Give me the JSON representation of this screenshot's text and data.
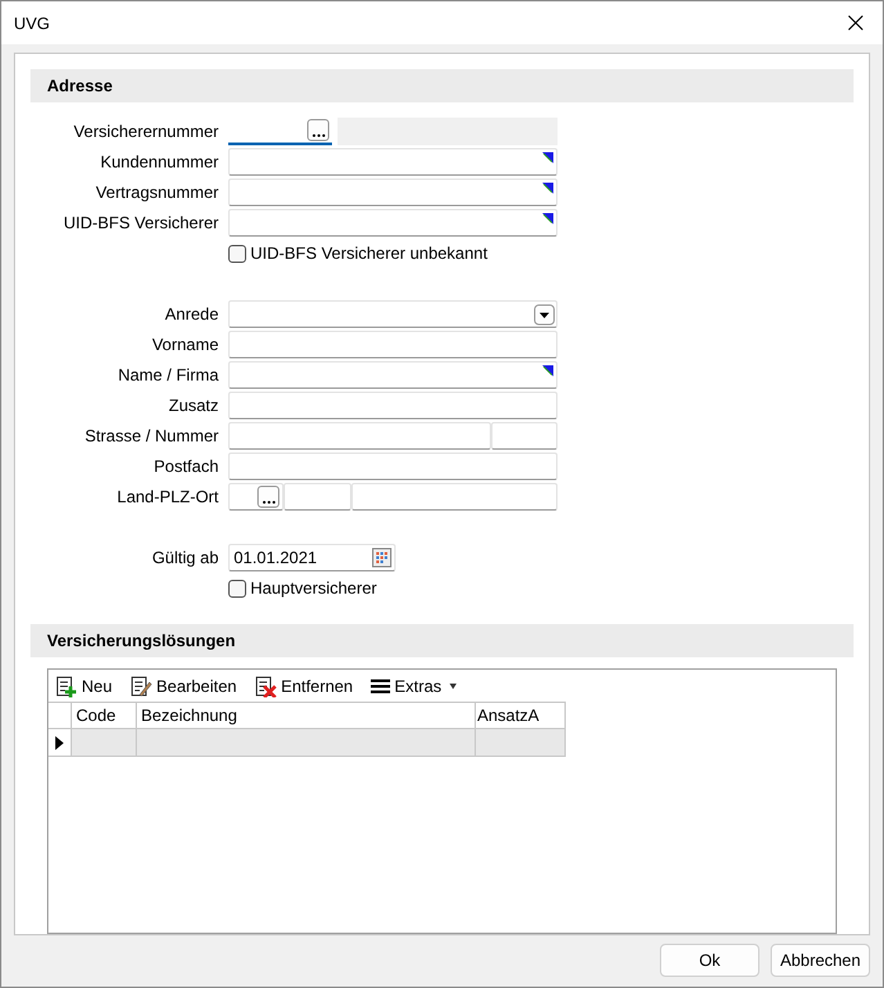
{
  "window": {
    "title": "UVG"
  },
  "address": {
    "title": "Adresse",
    "groups": [
      [
        {
          "kind": "lookup",
          "label": "Versicherernummer",
          "focused": true
        },
        {
          "kind": "text",
          "label": "Kundennummer",
          "marker": true
        },
        {
          "kind": "text",
          "label": "Vertragsnummer",
          "marker": true
        },
        {
          "kind": "text",
          "label": "UID-BFS Versicherer",
          "marker": true
        },
        {
          "kind": "checkbox",
          "label": "UID-BFS Versicherer unbekannt",
          "checked": false
        }
      ],
      [
        {
          "kind": "dropdown",
          "label": "Anrede"
        },
        {
          "kind": "text",
          "label": "Vorname",
          "marker": false
        },
        {
          "kind": "text",
          "label": "Name / Firma",
          "marker": true
        },
        {
          "kind": "text",
          "label": "Zusatz",
          "marker": false
        },
        {
          "kind": "split",
          "label": "Strasse / Nummer"
        },
        {
          "kind": "text",
          "label": "Postfach",
          "marker": false
        },
        {
          "kind": "place",
          "label": "Land-PLZ-Ort"
        }
      ],
      [
        {
          "kind": "date",
          "label": "Gültig ab",
          "value": "01.01.2021"
        },
        {
          "kind": "checkbox",
          "label": "Hauptversicherer",
          "checked": false
        }
      ]
    ]
  },
  "solutions": {
    "title": "Versicherungslösungen",
    "toolbar": [
      {
        "kind": "add",
        "label": "Neu"
      },
      {
        "kind": "edit",
        "label": "Bearbeiten"
      },
      {
        "kind": "delete",
        "label": "Entfernen"
      },
      {
        "kind": "menu",
        "label": "Extras"
      }
    ],
    "columns": [
      "Code",
      "Bezeichnung",
      "AnsatzA"
    ],
    "rows": [
      {
        "current": true
      }
    ]
  },
  "buttons": [
    "Ok",
    "Abbrechen"
  ]
}
